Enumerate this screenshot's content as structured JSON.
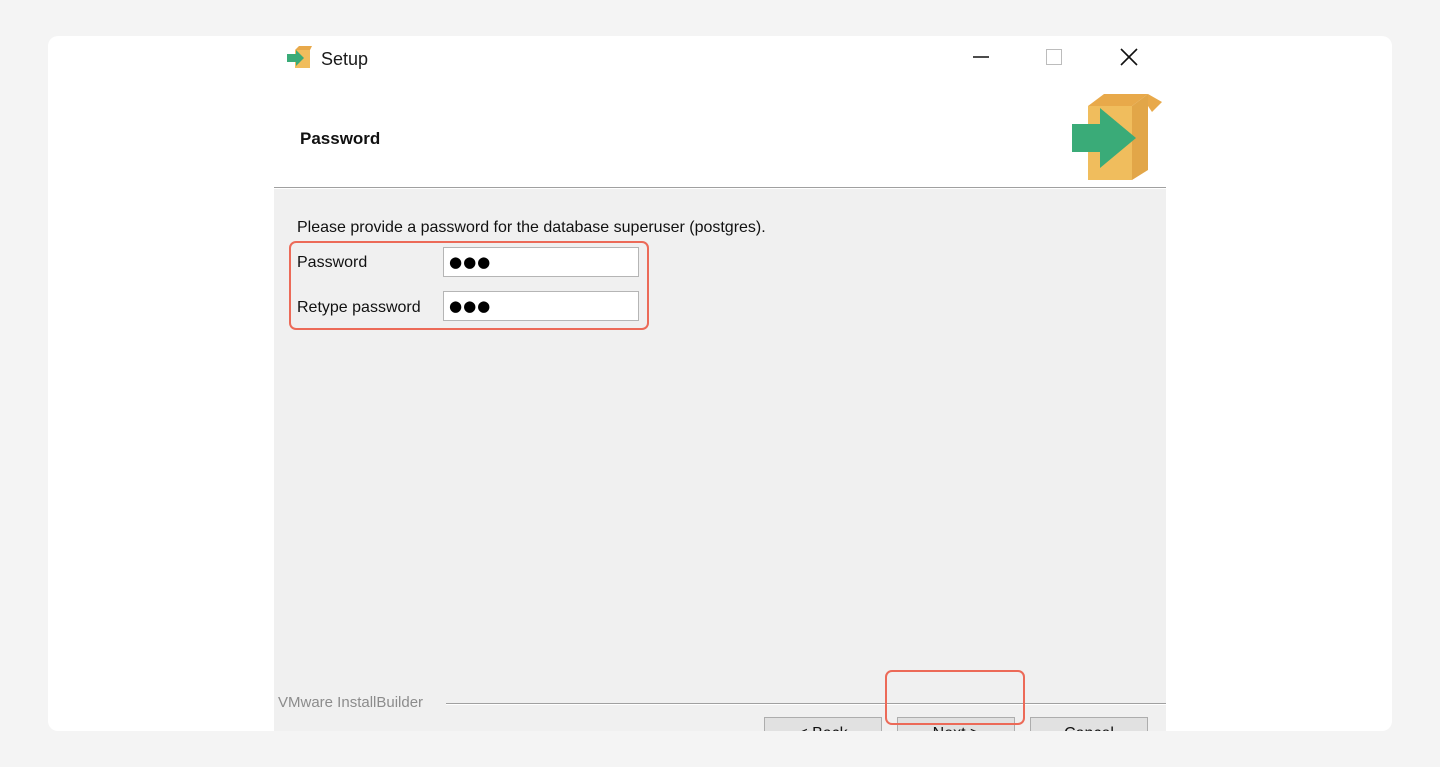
{
  "window": {
    "title": "Setup",
    "app_icon": "installer-box-arrow-icon",
    "controls": {
      "minimize_icon": "minimize-icon",
      "maximize_icon": "maximize-icon",
      "close_icon": "close-icon"
    }
  },
  "header": {
    "page_title": "Password",
    "logo_icon": "installer-box-arrow-icon"
  },
  "body": {
    "instruction": "Please provide a password for the database superuser (postgres).",
    "fields": [
      {
        "label": "Password",
        "value": "●●●"
      },
      {
        "label": "Retype password",
        "value": "●●●"
      }
    ]
  },
  "footer": {
    "brand": "VMware InstallBuilder",
    "buttons": {
      "back": "< Back",
      "next": "Next >",
      "cancel": "Cancel"
    }
  },
  "colors": {
    "highlight": "#ec6a58",
    "box": "#f0bd5d",
    "arrow": "#3aab78",
    "panel": "#f0f0f0"
  }
}
